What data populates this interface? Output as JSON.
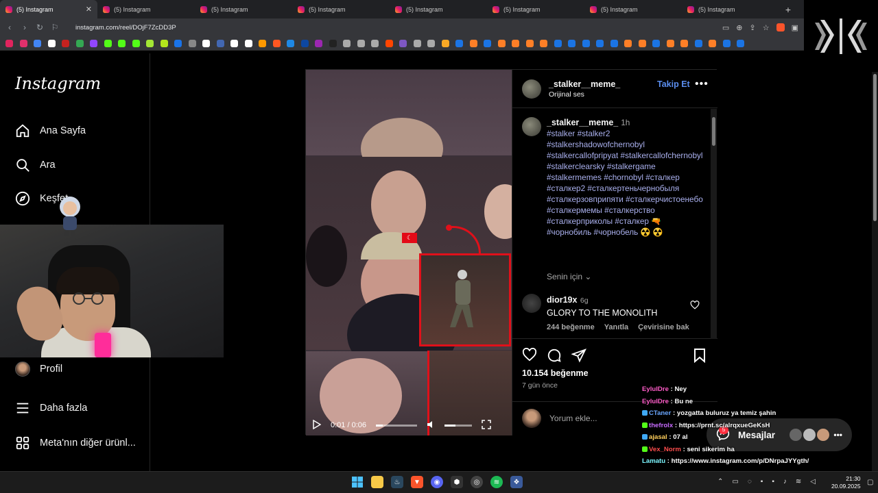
{
  "browser": {
    "tabs": [
      {
        "title": "(5) Instagram",
        "active": true
      },
      {
        "title": "(5) Instagram"
      },
      {
        "title": "(5) Instagram"
      },
      {
        "title": "(5) Instagram"
      },
      {
        "title": "(5) Instagram"
      },
      {
        "title": "(5) Instagram"
      },
      {
        "title": "(5) Instagram"
      },
      {
        "title": "(5) Instagram"
      }
    ],
    "new_tab_label": "+",
    "close_label": "✕",
    "url": "instagram.com/reel/DOjF7ZcDD3P",
    "bookmark_colors": [
      "#e0245e",
      "#e1306c",
      "#4285f4",
      "#ffffff",
      "#c5221f",
      "#34a853",
      "#9146ff",
      "#53fc18",
      "#53fc18",
      "#53fc18",
      "#a3e635",
      "#b4e61d",
      "#1a73e8",
      "#888888",
      "#ffffff",
      "#4267b2",
      "#ffffff",
      "#ffffff",
      "#ff9900",
      "#ff5722",
      "#1e88e5",
      "#0d47a1",
      "#9c27b0",
      "#222222",
      "#aaaaaa",
      "#aaaaaa",
      "#aaaaaa",
      "#ff4500",
      "#7e57c2",
      "#aaaaaa",
      "#aaaaaa",
      "#f9a825",
      "#1b74e4",
      "#ff7f27",
      "#1b74e4",
      "#ff7f27",
      "#ff7f27",
      "#ff7f27",
      "#ff7f27",
      "#1b74e4",
      "#1b74e4",
      "#1b74e4",
      "#1b74e4",
      "#1b74e4",
      "#ff7f27",
      "#ff7f27",
      "#1b74e4",
      "#ff7f27",
      "#ff7f27",
      "#1b74e4",
      "#ff7f27",
      "#1b74e4",
      "#1b74e4"
    ]
  },
  "sidebar": {
    "logo": "Instagram",
    "items": [
      {
        "label": "Ana Sayfa",
        "icon": "home-icon"
      },
      {
        "label": "Ara",
        "icon": "search-icon"
      },
      {
        "label": "Keşfet",
        "icon": "compass-icon"
      },
      {
        "label": "Profil",
        "icon": "avatar"
      },
      {
        "label": "Daha fazla",
        "icon": "menu-icon"
      },
      {
        "label": "Meta'nın diğer ürünl...",
        "icon": "grid-icon"
      }
    ]
  },
  "video": {
    "time": "0:01 / 0:06",
    "progress": 0.17,
    "volume": 0.4
  },
  "post": {
    "username": "_stalker__meme_",
    "audio": "Orijinal ses",
    "follow_label": "Takip Et",
    "caption_time": "1h",
    "hashtags": "#stalker #stalker2 #stalkershadowofchernobyl #stalkercallofpripyat #stalkercallofchernobyl #stalkerclearsky #stalkergame #stalkermemes #chornobyl #сталкер #сталкер2 #сталкертеньчернобыля #сталкерзовприпяти #сталкерчистоенебо #сталкермемы #сталкерство #сталкерприколы #сталкер 🔫 #чорнобиль #чорнобель ☢️ ☢️",
    "for_you_label": "Senin için",
    "comment": {
      "user": "dior19x",
      "time": "6g",
      "text": "GLORY TO THE MONOLITH",
      "likes": "244 beğenme",
      "reply": "Yanıtla",
      "translate": "Çevirisine bak"
    },
    "like_count": "10.154 beğenme",
    "posted_ago": "7 gün önce",
    "comment_placeholder": "Yorum ekle..."
  },
  "chat": [
    {
      "user": "EylulDre",
      "color": "#ff5cc8",
      "text": "Ney",
      "badge": ""
    },
    {
      "user": "EylulDre",
      "color": "#ff5cc8",
      "text": "Bu ne",
      "badge": ""
    },
    {
      "user": "CTaner",
      "color": "#6aa7ff",
      "text": "yozgatta buluruz ya temiz şahin",
      "badge": "#3fa9f5"
    },
    {
      "user": "thefrolx",
      "color": "#c76bff",
      "text": "https://prnt.sc/alrqxueGeKsH",
      "badge": "#53fc18"
    },
    {
      "user": "ajasal",
      "color": "#ffcf5c",
      "text": "07 al",
      "badge": "#3fa9f5"
    },
    {
      "user": "Vex_Norm",
      "color": "#ff4d4d",
      "text": "seni sikerim ha",
      "badge": "#53fc18"
    },
    {
      "user": "Lamatu",
      "color": "#7cf5ff",
      "text": "https://www.instagram.com/p/DNrpaJYYgth/",
      "badge": ""
    }
  ],
  "messages": {
    "label": "Mesajlar",
    "badge": "5"
  },
  "taskbar": {
    "time": "21:30",
    "date": "20.09.2025"
  }
}
